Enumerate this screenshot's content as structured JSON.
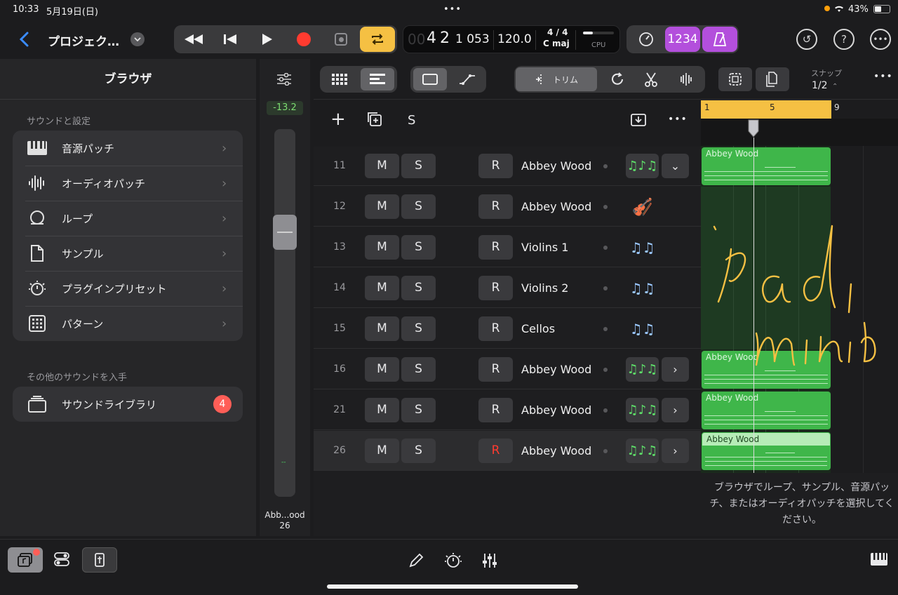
{
  "status": {
    "time": "10:33",
    "date": "5月19日(日)",
    "dots": "•••",
    "battery": "43%"
  },
  "header": {
    "project_title": "プロジェク…"
  },
  "lcd": {
    "position_hint": "00",
    "bar": "4",
    "beat": "2",
    "tick": "1 053",
    "tempo": "120.0",
    "signature": "4 / 4",
    "key": "C maj",
    "cpu_label": "CPU"
  },
  "count_in": "1234",
  "toolbar": {
    "trim_label": "トリム",
    "snap_label": "スナップ",
    "snap_value": "1/2"
  },
  "ruler": {
    "marks": [
      "1",
      "5",
      "9"
    ]
  },
  "browser": {
    "title": "ブラウザ",
    "sounds_heading": "サウンドと設定",
    "items": [
      {
        "label": "音源パッチ",
        "icon": "piano-icon"
      },
      {
        "label": "オーディオパッチ",
        "icon": "waveform-icon"
      },
      {
        "label": "ループ",
        "icon": "loop-icon"
      },
      {
        "label": "サンプル",
        "icon": "document-icon"
      },
      {
        "label": "プラグインプリセット",
        "icon": "plugin-preset-icon"
      },
      {
        "label": "パターン",
        "icon": "pattern-grid-icon"
      }
    ],
    "more_heading": "その他のサウンドを入手",
    "library_label": "サウンドライブラリ",
    "library_badge": "4"
  },
  "fader": {
    "level": "-13.2",
    "track_name": "Abb...ood",
    "track_number": "26",
    "meter_mark": "--"
  },
  "track_header_s": "S",
  "tracks": [
    {
      "number": "11",
      "mute": "M",
      "solo": "S",
      "rec": "R",
      "name": "Abbey Wood",
      "icon": "violin-ensemble-icon",
      "expand": "⌄",
      "record_armed": false
    },
    {
      "number": "12",
      "mute": "M",
      "solo": "S",
      "rec": "R",
      "name": "Abbey Wood",
      "icon": "violin-icon",
      "expand": "",
      "record_armed": false
    },
    {
      "number": "13",
      "mute": "M",
      "solo": "S",
      "rec": "R",
      "name": "Violins 1",
      "icon": "violins-icon",
      "expand": "",
      "record_armed": false
    },
    {
      "number": "14",
      "mute": "M",
      "solo": "S",
      "rec": "R",
      "name": "Violins 2",
      "icon": "violins-icon",
      "expand": "",
      "record_armed": false
    },
    {
      "number": "15",
      "mute": "M",
      "solo": "S",
      "rec": "R",
      "name": "Cellos",
      "icon": "violins-icon",
      "expand": "",
      "record_armed": false
    },
    {
      "number": "16",
      "mute": "M",
      "solo": "S",
      "rec": "R",
      "name": "Abbey Wood",
      "icon": "violin-ensemble-icon",
      "expand": "›",
      "record_armed": false
    },
    {
      "number": "21",
      "mute": "M",
      "solo": "S",
      "rec": "R",
      "name": "Abbey Wood",
      "icon": "violin-ensemble-icon",
      "expand": "›",
      "record_armed": false
    },
    {
      "number": "26",
      "mute": "M",
      "solo": "S",
      "rec": "R",
      "name": "Abbey Wood",
      "icon": "violin-ensemble-icon",
      "expand": "›",
      "record_armed": true
    }
  ],
  "regions": [
    {
      "name": "Abbey Wood"
    },
    {
      "name": "Abbey Wood"
    },
    {
      "name": "Abbey Wood"
    },
    {
      "name": "Abbey Wood"
    }
  ],
  "hint_text": "ブラウザでループ、サンプル、音源パッチ、またはオーディオパッチを選択してください。",
  "colors": {
    "accent_yellow": "#f5c043",
    "region_green": "#3fb64a",
    "record_red": "#ff3b30",
    "purple": "#b34fdc"
  }
}
